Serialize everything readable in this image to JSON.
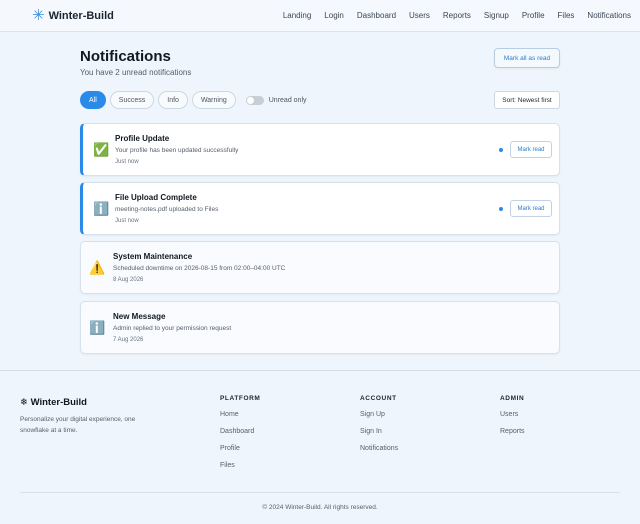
{
  "header": {
    "brand_icon": "snowflake-icon",
    "brand_name": "Winter-Build",
    "nav": [
      "Landing",
      "Login",
      "Dashboard",
      "Users",
      "Reports",
      "Signup",
      "Profile",
      "Files",
      "Notifications"
    ]
  },
  "page": {
    "title": "Notifications",
    "subtitle": "You have 2 unread notifications",
    "mark_all_label": "Mark all as read"
  },
  "filters": {
    "pills": [
      "All",
      "Success",
      "Info",
      "Warning"
    ],
    "active": "All",
    "unread_only_label": "Unread only",
    "unread_only_on": false,
    "sort_label": "Sort: Newest first"
  },
  "notifications": [
    {
      "icon": "check-icon",
      "glyph": "✅",
      "title": "Profile Update",
      "message": "Your profile has been updated successfully",
      "time": "Just now",
      "unread": true,
      "action": "Mark read"
    },
    {
      "icon": "info-icon",
      "glyph": "ℹ️",
      "title": "File Upload Complete",
      "message": "meeting-notes.pdf uploaded to Files",
      "time": "Just now",
      "unread": true,
      "action": "Mark read"
    },
    {
      "icon": "warning-icon",
      "glyph": "⚠️",
      "title": "System Maintenance",
      "message": "Scheduled downtime on 2026-08-15 from 02:00–04:00 UTC",
      "time": "8 Aug 2026",
      "unread": false
    },
    {
      "icon": "info-icon",
      "glyph": "ℹ️",
      "title": "New Message",
      "message": "Admin replied to your permission request",
      "time": "7 Aug 2026",
      "unread": false
    }
  ],
  "footer": {
    "brand": "❄ Winter-Build",
    "description": "Personalize your digital experience, one snowflake at a time.",
    "columns": [
      {
        "heading": "PLATFORM",
        "links": [
          "Home",
          "Dashboard",
          "Profile",
          "Files"
        ]
      },
      {
        "heading": "ACCOUNT",
        "links": [
          "Sign Up",
          "Sign In",
          "Notifications"
        ]
      },
      {
        "heading": "ADMIN",
        "links": [
          "Users",
          "Reports"
        ]
      }
    ],
    "copyright": "© 2024 Winter-Build. All rights reserved."
  },
  "colors": {
    "accent": "#2a8ae8",
    "background": "#eef5fd"
  }
}
